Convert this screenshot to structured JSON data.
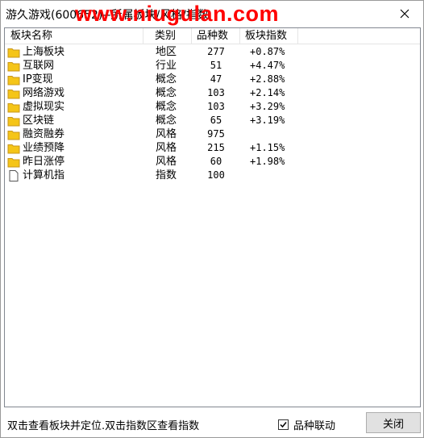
{
  "window": {
    "title": "游久游戏(600652)--所属板块/风格/指数",
    "watermark": "www.niugulan.com"
  },
  "list": {
    "columns": [
      "板块名称",
      "类别",
      "品种数",
      "板块指数"
    ],
    "rows": [
      {
        "name": "上海板块",
        "type": "地区",
        "count": "277",
        "index": "+0.87%",
        "icon": "folder-icon"
      },
      {
        "name": "互联网",
        "type": "行业",
        "count": "51",
        "index": "+4.47%",
        "icon": "folder-icon"
      },
      {
        "name": "IP变现",
        "type": "概念",
        "count": "47",
        "index": "+2.88%",
        "icon": "folder-icon"
      },
      {
        "name": "网络游戏",
        "type": "概念",
        "count": "103",
        "index": "+2.14%",
        "icon": "folder-icon"
      },
      {
        "name": "虚拟现实",
        "type": "概念",
        "count": "103",
        "index": "+3.29%",
        "icon": "folder-icon"
      },
      {
        "name": "区块链",
        "type": "概念",
        "count": "65",
        "index": "+3.19%",
        "icon": "folder-icon"
      },
      {
        "name": "融资融券",
        "type": "风格",
        "count": "975",
        "index": "",
        "icon": "folder-icon"
      },
      {
        "name": "业绩预降",
        "type": "风格",
        "count": "215",
        "index": "+1.15%",
        "icon": "folder-icon"
      },
      {
        "name": "昨日涨停",
        "type": "风格",
        "count": "60",
        "index": "+1.98%",
        "icon": "folder-icon"
      },
      {
        "name": "计算机指",
        "type": "指数",
        "count": "100",
        "index": "",
        "icon": "document-icon"
      }
    ]
  },
  "statusbar": {
    "hint": "双击查看板块并定位.双击指数区查看指数",
    "checkbox_label": "品种联动",
    "checkbox_checked": true,
    "close_label": "关闭"
  },
  "colors": {
    "watermark": "#ff0000",
    "folder_fill": "#f5c518",
    "folder_edge": "#c8961a"
  }
}
